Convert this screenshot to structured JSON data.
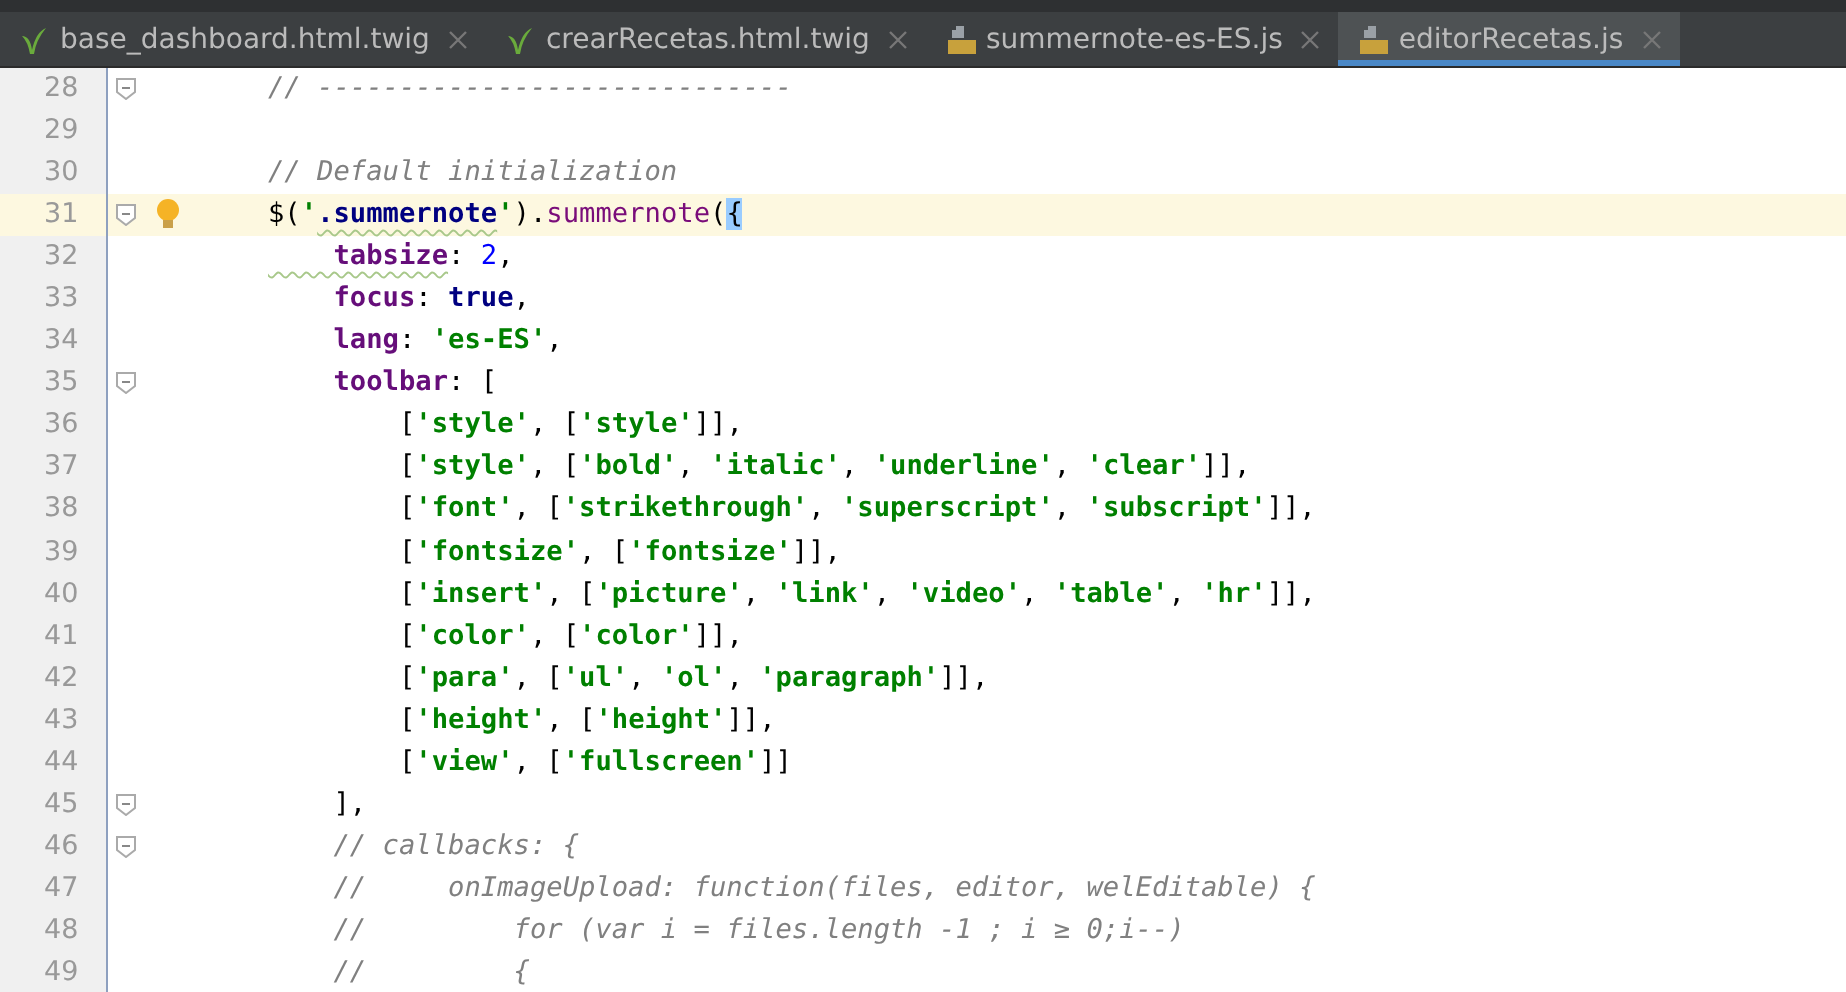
{
  "tabs": [
    {
      "label": "base_dashboard.html.twig",
      "kind": "twig",
      "selected": false
    },
    {
      "label": "crearRecetas.html.twig",
      "kind": "twig",
      "selected": false
    },
    {
      "label": "summernote-es-ES.js",
      "kind": "js",
      "selected": false
    },
    {
      "label": "editorRecetas.js",
      "kind": "js",
      "selected": true
    }
  ],
  "lines": [
    {
      "number": "28",
      "fold": true,
      "current": false,
      "hint": false,
      "code": [
        {
          "kind": "comment",
          "text": "// -----------------------------"
        }
      ]
    },
    {
      "number": "29",
      "fold": false,
      "current": false,
      "hint": false
    },
    {
      "number": "30",
      "fold": false,
      "current": false,
      "hint": false,
      "code": [
        {
          "kind": "comment",
          "text": "// Default initialization"
        }
      ]
    },
    {
      "number": "31",
      "fold": true,
      "current": true,
      "hint": true,
      "code": [
        {
          "kind": "plain",
          "text": "$("
        },
        {
          "kind": "string",
          "text": "'"
        },
        {
          "kind": "selector",
          "text": ".summernote",
          "warning": true
        },
        {
          "kind": "string",
          "text": "'"
        },
        {
          "kind": "plain",
          "text": ")."
        },
        {
          "kind": "method",
          "text": "summernote"
        },
        {
          "kind": "plain",
          "text": "("
        },
        {
          "kind": "brace",
          "text": "{"
        }
      ]
    },
    {
      "number": "32",
      "fold": false,
      "current": false,
      "hint": false,
      "code": [
        {
          "kind": "property",
          "text": "    tabsize",
          "warning": true
        },
        {
          "kind": "plain",
          "text": ": "
        },
        {
          "kind": "number",
          "text": "2"
        },
        {
          "kind": "plain",
          "text": ","
        }
      ]
    },
    {
      "number": "33",
      "fold": false,
      "current": false,
      "hint": false,
      "code": [
        {
          "kind": "property",
          "text": "    focus"
        },
        {
          "kind": "plain",
          "text": ": "
        },
        {
          "kind": "keyword",
          "text": "true"
        },
        {
          "kind": "plain",
          "text": ","
        }
      ]
    },
    {
      "number": "34",
      "fold": false,
      "current": false,
      "hint": false,
      "code": [
        {
          "kind": "property",
          "text": "    lang"
        },
        {
          "kind": "plain",
          "text": ": "
        },
        {
          "kind": "string",
          "text": "'es-ES'"
        },
        {
          "kind": "plain",
          "text": ","
        }
      ]
    },
    {
      "number": "35",
      "fold": true,
      "current": false,
      "hint": false,
      "code": [
        {
          "kind": "property",
          "text": "    toolbar"
        },
        {
          "kind": "plain",
          "text": ": ["
        }
      ]
    },
    {
      "number": "36",
      "fold": false,
      "current": false,
      "hint": false,
      "code": [
        {
          "kind": "plain",
          "text": "        ["
        },
        {
          "kind": "string",
          "text": "'style'"
        },
        {
          "kind": "plain",
          "text": ", ["
        },
        {
          "kind": "string",
          "text": "'style'"
        },
        {
          "kind": "plain",
          "text": "]],"
        }
      ]
    },
    {
      "number": "37",
      "fold": false,
      "current": false,
      "hint": false,
      "code": [
        {
          "kind": "plain",
          "text": "        ["
        },
        {
          "kind": "string",
          "text": "'style'"
        },
        {
          "kind": "plain",
          "text": ", ["
        },
        {
          "kind": "string",
          "text": "'bold'"
        },
        {
          "kind": "plain",
          "text": ", "
        },
        {
          "kind": "string",
          "text": "'italic'"
        },
        {
          "kind": "plain",
          "text": ", "
        },
        {
          "kind": "string",
          "text": "'underline'"
        },
        {
          "kind": "plain",
          "text": ", "
        },
        {
          "kind": "string",
          "text": "'clear'"
        },
        {
          "kind": "plain",
          "text": "]],"
        }
      ]
    },
    {
      "number": "38",
      "fold": false,
      "current": false,
      "hint": false,
      "code": [
        {
          "kind": "plain",
          "text": "        ["
        },
        {
          "kind": "string",
          "text": "'font'"
        },
        {
          "kind": "plain",
          "text": ", ["
        },
        {
          "kind": "string",
          "text": "'strikethrough'"
        },
        {
          "kind": "plain",
          "text": ", "
        },
        {
          "kind": "string",
          "text": "'superscript'"
        },
        {
          "kind": "plain",
          "text": ", "
        },
        {
          "kind": "string",
          "text": "'subscript'"
        },
        {
          "kind": "plain",
          "text": "]],"
        }
      ]
    },
    {
      "number": "39",
      "fold": false,
      "current": false,
      "hint": false,
      "code": [
        {
          "kind": "plain",
          "text": "        ["
        },
        {
          "kind": "string",
          "text": "'fontsize'"
        },
        {
          "kind": "plain",
          "text": ", ["
        },
        {
          "kind": "string",
          "text": "'fontsize'"
        },
        {
          "kind": "plain",
          "text": "]],"
        }
      ]
    },
    {
      "number": "40",
      "fold": false,
      "current": false,
      "hint": false,
      "code": [
        {
          "kind": "plain",
          "text": "        ["
        },
        {
          "kind": "string",
          "text": "'insert'"
        },
        {
          "kind": "plain",
          "text": ", ["
        },
        {
          "kind": "string",
          "text": "'picture'"
        },
        {
          "kind": "plain",
          "text": ", "
        },
        {
          "kind": "string",
          "text": "'link'"
        },
        {
          "kind": "plain",
          "text": ", "
        },
        {
          "kind": "string",
          "text": "'video'"
        },
        {
          "kind": "plain",
          "text": ", "
        },
        {
          "kind": "string",
          "text": "'table'"
        },
        {
          "kind": "plain",
          "text": ", "
        },
        {
          "kind": "string",
          "text": "'hr'"
        },
        {
          "kind": "plain",
          "text": "]],"
        }
      ]
    },
    {
      "number": "41",
      "fold": false,
      "current": false,
      "hint": false,
      "code": [
        {
          "kind": "plain",
          "text": "        ["
        },
        {
          "kind": "string",
          "text": "'color'"
        },
        {
          "kind": "plain",
          "text": ", ["
        },
        {
          "kind": "string",
          "text": "'color'"
        },
        {
          "kind": "plain",
          "text": "]],"
        }
      ]
    },
    {
      "number": "42",
      "fold": false,
      "current": false,
      "hint": false,
      "code": [
        {
          "kind": "plain",
          "text": "        ["
        },
        {
          "kind": "string",
          "text": "'para'"
        },
        {
          "kind": "plain",
          "text": ", ["
        },
        {
          "kind": "string",
          "text": "'ul'"
        },
        {
          "kind": "plain",
          "text": ", "
        },
        {
          "kind": "string",
          "text": "'ol'"
        },
        {
          "kind": "plain",
          "text": ", "
        },
        {
          "kind": "string",
          "text": "'paragraph'"
        },
        {
          "kind": "plain",
          "text": "]],"
        }
      ]
    },
    {
      "number": "43",
      "fold": false,
      "current": false,
      "hint": false,
      "code": [
        {
          "kind": "plain",
          "text": "        ["
        },
        {
          "kind": "string",
          "text": "'height'"
        },
        {
          "kind": "plain",
          "text": ", ["
        },
        {
          "kind": "string",
          "text": "'height'"
        },
        {
          "kind": "plain",
          "text": "]],"
        }
      ]
    },
    {
      "number": "44",
      "fold": false,
      "current": false,
      "hint": false,
      "code": [
        {
          "kind": "plain",
          "text": "        ["
        },
        {
          "kind": "string",
          "text": "'view'"
        },
        {
          "kind": "plain",
          "text": ", ["
        },
        {
          "kind": "string",
          "text": "'fullscreen'"
        },
        {
          "kind": "plain",
          "text": "]]"
        }
      ]
    },
    {
      "number": "45",
      "fold": true,
      "current": false,
      "hint": false,
      "code": [
        {
          "kind": "plain",
          "text": "    ],"
        }
      ]
    },
    {
      "number": "46",
      "fold": true,
      "current": false,
      "hint": false,
      "code": [
        {
          "kind": "comment",
          "text": "    // callbacks: {"
        }
      ]
    },
    {
      "number": "47",
      "fold": false,
      "current": false,
      "hint": false,
      "code": [
        {
          "kind": "comment",
          "text": "    //     onImageUpload: function(files, editor, welEditable) {"
        }
      ]
    },
    {
      "number": "48",
      "fold": false,
      "current": false,
      "hint": false,
      "code": [
        {
          "kind": "comment",
          "text": "    //         for (var i = files.length -1 ; i ≥ 0;i--)"
        }
      ]
    },
    {
      "number": "49",
      "fold": false,
      "current": false,
      "hint": false,
      "code": [
        {
          "kind": "comment",
          "text": "    //         {"
        }
      ]
    }
  ]
}
